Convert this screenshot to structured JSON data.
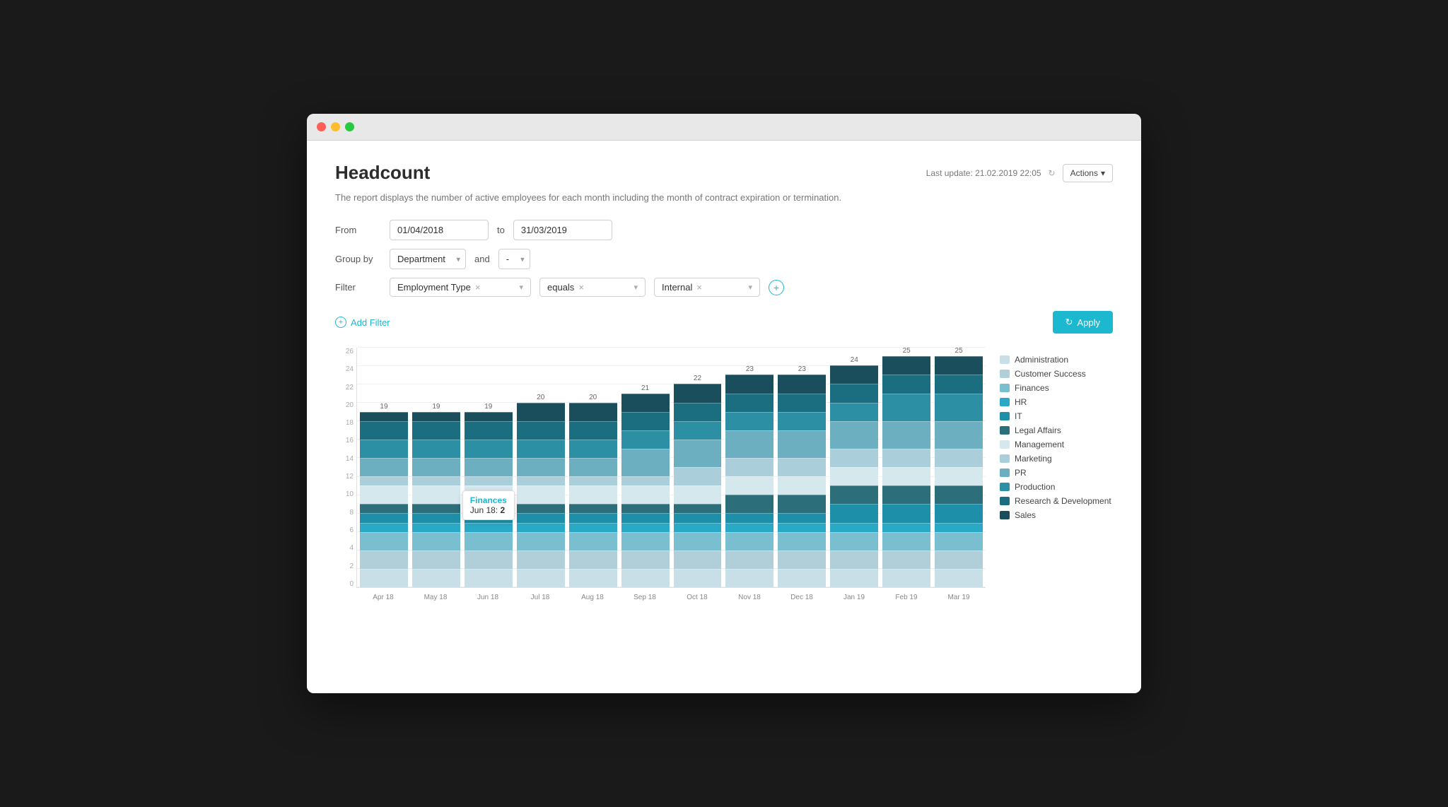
{
  "window": {
    "title": "Headcount"
  },
  "header": {
    "title": "Headcount",
    "last_update_label": "Last update: 21.02.2019 22:05",
    "actions_label": "Actions",
    "description": "The report displays the number of active employees for each month including the month of contract expiration or termination."
  },
  "filters": {
    "from_label": "From",
    "from_value": "01/04/2018",
    "to_label": "to",
    "to_value": "31/03/2019",
    "group_by_label": "Group by",
    "group_by_value": "Department",
    "and_label": "and",
    "secondary_group": "-",
    "filter_label": "Filter",
    "filter_field": "Employment Type",
    "filter_op": "equals",
    "filter_value": "Internal",
    "add_filter_label": "Add Filter",
    "apply_label": "Apply"
  },
  "chart": {
    "bars": [
      {
        "month": "Apr 18",
        "total": 19,
        "segments": [
          2,
          2,
          2,
          1,
          1,
          1,
          2,
          1,
          2,
          2,
          2,
          1
        ]
      },
      {
        "month": "May 18",
        "total": 19,
        "segments": [
          2,
          2,
          2,
          1,
          1,
          1,
          2,
          1,
          2,
          2,
          2,
          1
        ]
      },
      {
        "month": "Jun 18",
        "total": 19,
        "segments": [
          2,
          2,
          2,
          1,
          1,
          1,
          2,
          1,
          2,
          2,
          2,
          1
        ]
      },
      {
        "month": "Jul 18",
        "total": 20,
        "segments": [
          2,
          2,
          2,
          1,
          1,
          1,
          2,
          1,
          2,
          2,
          2,
          2
        ]
      },
      {
        "month": "Aug 18",
        "total": 20,
        "segments": [
          2,
          2,
          2,
          1,
          1,
          1,
          2,
          1,
          2,
          2,
          2,
          2
        ]
      },
      {
        "month": "Sep 18",
        "total": 21,
        "segments": [
          2,
          2,
          2,
          1,
          1,
          1,
          2,
          1,
          3,
          2,
          2,
          2
        ]
      },
      {
        "month": "Oct 18",
        "total": 22,
        "segments": [
          2,
          2,
          2,
          1,
          1,
          1,
          2,
          2,
          3,
          2,
          2,
          2
        ]
      },
      {
        "month": "Nov 18",
        "total": 23,
        "segments": [
          2,
          2,
          2,
          1,
          1,
          2,
          2,
          2,
          3,
          2,
          2,
          2
        ]
      },
      {
        "month": "Dec 18",
        "total": 23,
        "segments": [
          2,
          2,
          2,
          1,
          1,
          2,
          2,
          2,
          3,
          2,
          2,
          2
        ]
      },
      {
        "month": "Jan 19",
        "total": 24,
        "segments": [
          2,
          2,
          2,
          1,
          2,
          2,
          2,
          2,
          3,
          2,
          2,
          2
        ]
      },
      {
        "month": "Feb 19",
        "total": 25,
        "segments": [
          2,
          2,
          2,
          1,
          2,
          2,
          2,
          2,
          3,
          3,
          2,
          2
        ]
      },
      {
        "month": "Mar 19",
        "total": 25,
        "segments": [
          2,
          2,
          2,
          1,
          2,
          2,
          2,
          2,
          3,
          3,
          2,
          2
        ]
      }
    ],
    "tooltip": {
      "title": "Finances",
      "date": "Jun 18:",
      "value": "2"
    },
    "tooltip_bar_index": 2,
    "y_labels": [
      "0",
      "2",
      "4",
      "6",
      "8",
      "10",
      "12",
      "14",
      "16",
      "18",
      "20",
      "22",
      "24",
      "26"
    ],
    "max_value": 26
  },
  "legend": {
    "items": [
      {
        "label": "Administration",
        "color": "#c8dfe8"
      },
      {
        "label": "Customer Success",
        "color": "#b0cfd9"
      },
      {
        "label": "Finances",
        "color": "#79bfcf"
      },
      {
        "label": "HR",
        "color": "#29a9c5"
      },
      {
        "label": "IT",
        "color": "#1e8fa8"
      },
      {
        "label": "Legal Affairs",
        "color": "#2c6e7a"
      },
      {
        "label": "Management",
        "color": "#d4e8ee"
      },
      {
        "label": "Marketing",
        "color": "#aacfda"
      },
      {
        "label": "PR",
        "color": "#6bafc0"
      },
      {
        "label": "Production",
        "color": "#2d8fa3"
      },
      {
        "label": "Research & Development",
        "color": "#1a6e80"
      },
      {
        "label": "Sales",
        "color": "#1a4e5c"
      }
    ]
  }
}
